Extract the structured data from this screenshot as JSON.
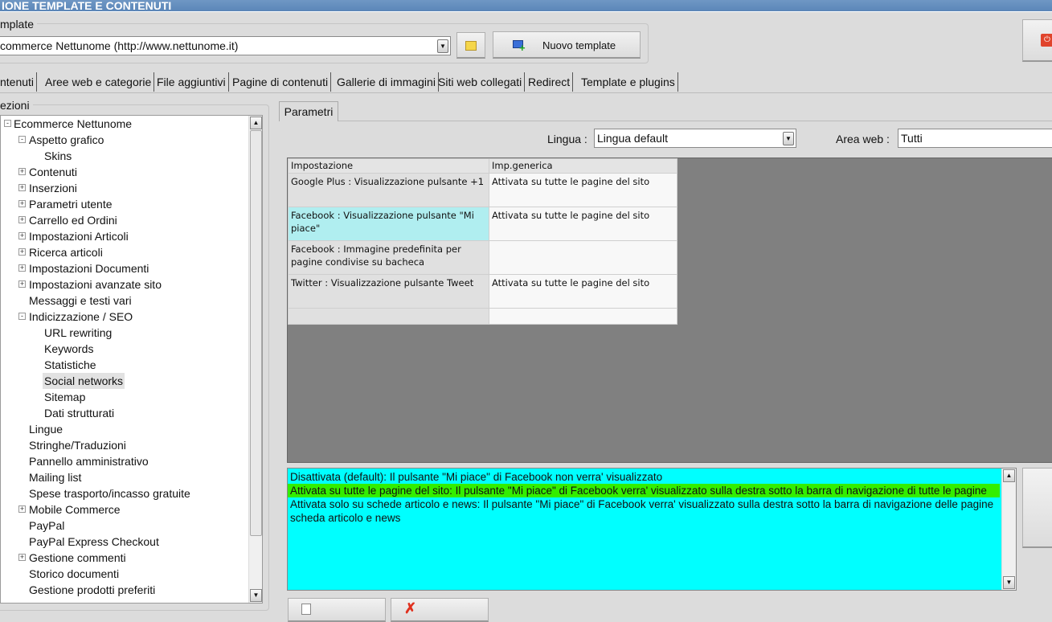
{
  "window": {
    "title": "IONE TEMPLATE E CONTENUTI"
  },
  "template_group": {
    "legend": "mplate",
    "selected": "commerce Nettunome (http://www.nettunome.it)",
    "new_button": "Nuovo template"
  },
  "tabs": [
    "ntenuti",
    "Aree web e categorie",
    "File aggiuntivi",
    "Pagine di contenuti",
    "Gallerie di immagini",
    "Siti web collegati",
    "Redirect",
    "Template e plugins"
  ],
  "sections": {
    "legend": "ezioni",
    "tree": [
      {
        "label": "Ecommerce Nettunome",
        "level": 0,
        "exp": "-"
      },
      {
        "label": "Aspetto grafico",
        "level": 1,
        "exp": "-"
      },
      {
        "label": "Skins",
        "level": 2
      },
      {
        "label": "Contenuti",
        "level": 1,
        "exp": "+"
      },
      {
        "label": "Inserzioni",
        "level": 1,
        "exp": "+"
      },
      {
        "label": "Parametri utente",
        "level": 1,
        "exp": "+"
      },
      {
        "label": "Carrello ed Ordini",
        "level": 1,
        "exp": "+"
      },
      {
        "label": "Impostazioni Articoli",
        "level": 1,
        "exp": "+"
      },
      {
        "label": "Ricerca articoli",
        "level": 1,
        "exp": "+"
      },
      {
        "label": "Impostazioni Documenti",
        "level": 1,
        "exp": "+"
      },
      {
        "label": "Impostazioni avanzate sito",
        "level": 1,
        "exp": "+"
      },
      {
        "label": "Messaggi e testi vari",
        "level": 1
      },
      {
        "label": "Indicizzazione / SEO",
        "level": 1,
        "exp": "-"
      },
      {
        "label": "URL rewriting",
        "level": 2
      },
      {
        "label": "Keywords",
        "level": 2
      },
      {
        "label": "Statistiche",
        "level": 2
      },
      {
        "label": "Social networks",
        "level": 2,
        "selected": true
      },
      {
        "label": "Sitemap",
        "level": 2
      },
      {
        "label": "Dati strutturati",
        "level": 2
      },
      {
        "label": "Lingue",
        "level": 1
      },
      {
        "label": "Stringhe/Traduzioni",
        "level": 1
      },
      {
        "label": "Pannello amministrativo",
        "level": 1
      },
      {
        "label": "Mailing list",
        "level": 1
      },
      {
        "label": "Spese trasporto/incasso gratuite",
        "level": 1
      },
      {
        "label": "Mobile Commerce",
        "level": 1,
        "exp": "+"
      },
      {
        "label": "PayPal",
        "level": 1
      },
      {
        "label": "PayPal Express Checkout",
        "level": 1
      },
      {
        "label": "Gestione commenti",
        "level": 1,
        "exp": "+"
      },
      {
        "label": "Storico documenti",
        "level": 1
      },
      {
        "label": "Gestione prodotti preferiti",
        "level": 1
      }
    ]
  },
  "params": {
    "tab": "Parametri",
    "lingua_label": "Lingua :",
    "lingua_value": "Lingua default",
    "area_label": "Area web :",
    "area_value": "Tutti",
    "columns": [
      "Impostazione",
      "Imp.generica"
    ],
    "rows": [
      [
        "Google Plus : Visualizzazione pulsante +1",
        "Attivata su tutte le pagine del sito"
      ],
      [
        "Facebook : Visualizzazione pulsante \"Mi piace\"",
        "Attivata su tutte le pagine del sito"
      ],
      [
        "Facebook : Immagine predefinita per pagine condivise su bacheca",
        ""
      ],
      [
        "Twitter : Visualizzazione pulsante Tweet",
        "Attivata su tutte le pagine del sito"
      ],
      [
        "",
        ""
      ]
    ],
    "description": [
      "Disattivata (default): Il pulsante \"Mi piace\" di Facebook non verra' visualizzato",
      "Attivata su tutte le pagine del sito: Il pulsante \"Mi piace\" di Facebook verra' visualizzato sulla destra sotto la barra di navigazione di tutte le pagine",
      "Attivata solo su schede articolo e news: Il pulsante \"Mi piace\" di Facebook verra' visualizzato sulla destra sotto la barra di navigazione delle pagine scheda articolo e news"
    ]
  },
  "colors": {
    "desc_bg": "#00ffff",
    "desc_highlight": "#33ee00",
    "selected_row": "#b0eef0",
    "grid_bg": "#808080"
  }
}
